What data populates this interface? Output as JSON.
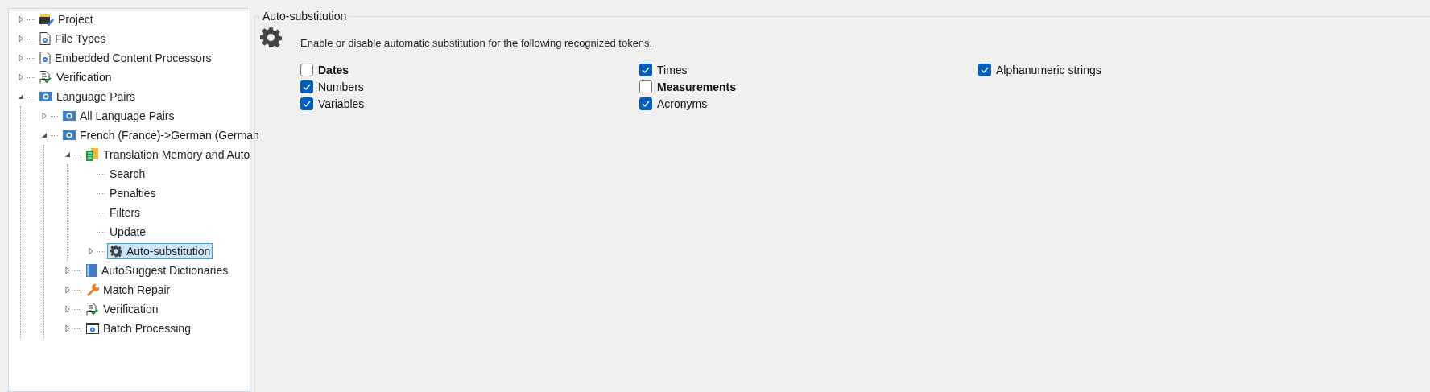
{
  "tree": [
    {
      "label": "Project",
      "kind": "project",
      "expanded": false,
      "selected": false
    },
    {
      "label": "File Types",
      "kind": "file-gear",
      "expanded": false,
      "selected": false
    },
    {
      "label": "Embedded Content Processors",
      "kind": "file-gear",
      "expanded": false,
      "selected": false
    },
    {
      "label": "Verification",
      "kind": "check-doc",
      "expanded": false,
      "selected": false
    },
    {
      "label": "Language Pairs",
      "kind": "globe",
      "expanded": true,
      "selected": false,
      "children": [
        {
          "label": "All Language Pairs",
          "kind": "globe",
          "expanded": false,
          "selected": false
        },
        {
          "label": "French (France)->German (German",
          "kind": "globe",
          "expanded": true,
          "selected": false,
          "children": [
            {
              "label": "Translation Memory and Auto",
              "kind": "tm",
              "expanded": true,
              "selected": false,
              "children": [
                {
                  "label": "Search",
                  "kind": "leaf",
                  "selected": false
                },
                {
                  "label": "Penalties",
                  "kind": "leaf",
                  "selected": false
                },
                {
                  "label": "Filters",
                  "kind": "leaf",
                  "selected": false
                },
                {
                  "label": "Update",
                  "kind": "leaf",
                  "selected": false
                },
                {
                  "label": "Auto-substitution",
                  "kind": "gear",
                  "expanded": false,
                  "selected": true
                }
              ]
            },
            {
              "label": "AutoSuggest Dictionaries",
              "kind": "book",
              "expanded": false,
              "selected": false
            },
            {
              "label": "Match Repair",
              "kind": "wrench",
              "expanded": false,
              "selected": false
            },
            {
              "label": "Verification",
              "kind": "check-doc",
              "expanded": false,
              "selected": false
            },
            {
              "label": "Batch Processing",
              "kind": "batch",
              "expanded": false,
              "selected": false
            }
          ]
        }
      ]
    }
  ],
  "group": {
    "title": "Auto-substitution",
    "description": "Enable or disable automatic substitution for the following recognized tokens.",
    "columns": [
      [
        {
          "label": "Dates",
          "checked": false,
          "emphasized": true
        },
        {
          "label": "Numbers",
          "checked": true,
          "emphasized": false
        },
        {
          "label": "Variables",
          "checked": true,
          "emphasized": false
        }
      ],
      [
        {
          "label": "Times",
          "checked": true,
          "emphasized": false
        },
        {
          "label": "Measurements",
          "checked": false,
          "emphasized": true
        },
        {
          "label": "Acronyms",
          "checked": true,
          "emphasized": false
        }
      ],
      [
        {
          "label": "Alphanumeric strings",
          "checked": true,
          "emphasized": false
        }
      ]
    ]
  }
}
